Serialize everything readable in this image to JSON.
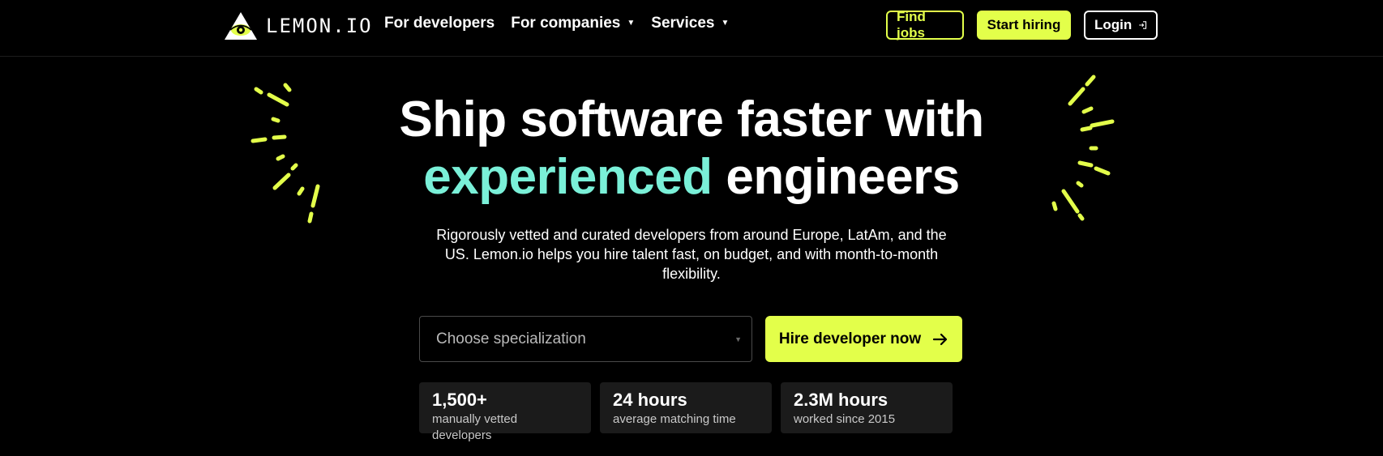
{
  "header": {
    "logo_text": "LEMON.IO",
    "nav": [
      {
        "label": "For developers",
        "has_caret": false
      },
      {
        "label": "For companies",
        "has_caret": true
      },
      {
        "label": "Services",
        "has_caret": true
      }
    ],
    "find_jobs_label": "Find jobs",
    "start_hiring_label": "Start hiring",
    "login_label": "Login"
  },
  "hero": {
    "title_line1": "Ship software faster with",
    "title_accent": "experienced",
    "title_rest": "engineers",
    "subtitle": "Rigorously vetted and curated developers from around Europe, LatAm, and the US. Lemon.io helps you hire talent fast, on budget, and with month-to-month flexibility.",
    "select_placeholder": "Choose specialization",
    "cta_label": "Hire developer now"
  },
  "stats": [
    {
      "value": "1,500+",
      "label": "manually vetted developers"
    },
    {
      "value": "24 hours",
      "label": "average matching time"
    },
    {
      "value": "2.3M hours",
      "label": "worked since 2015"
    }
  ],
  "colors": {
    "background": "#000000",
    "lime": "#e3ff4a",
    "accent_teal": "#7af0d8",
    "stat_card": "#1b1b1b"
  },
  "icons": [
    "lemon-eye-logo-icon",
    "caret-down-icon",
    "login-arrow-icon",
    "arrow-right-icon",
    "chevron-down-icon",
    "sparkle-lines-icon"
  ]
}
